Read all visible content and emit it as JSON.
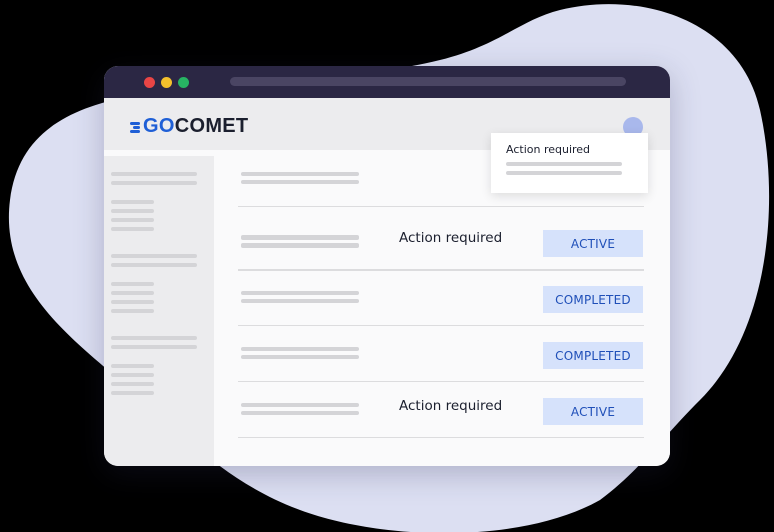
{
  "colors": {
    "blob": "#dcdff2",
    "titlebar": "#2b2744",
    "brand_blue": "#1f5fd6",
    "badge_bg": "#d6e2fb",
    "badge_text": "#1f4fb8"
  },
  "browser": {
    "window_controls": [
      "close",
      "minimize",
      "maximize"
    ]
  },
  "header": {
    "logo_go": "GO",
    "logo_comet": "COMET",
    "avatar_icon": "user-avatar-icon"
  },
  "popup": {
    "title": "Action required"
  },
  "rows": [
    {
      "action": "",
      "status": ""
    },
    {
      "action": "Action required",
      "status": "ACTIVE"
    },
    {
      "action": "",
      "status": "COMPLETED"
    },
    {
      "action": "",
      "status": "COMPLETED"
    },
    {
      "action": "Action required",
      "status": "ACTIVE"
    }
  ]
}
